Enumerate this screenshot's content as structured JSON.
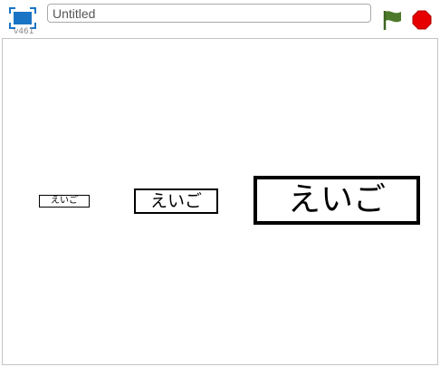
{
  "toolbar": {
    "fullscreen_icon": "fullscreen-icon",
    "version": "v461",
    "title_value": "Untitled",
    "flag_icon": "green-flag-icon",
    "stop_icon": "stop-icon",
    "flag_color": "#4d7a2a",
    "stop_color": "#e60000",
    "fullscreen_color": "#1a74c5"
  },
  "stage": {
    "sprites": [
      {
        "text": "えいご",
        "size": "small"
      },
      {
        "text": "えいご",
        "size": "medium"
      },
      {
        "text": "えいご",
        "size": "large"
      }
    ]
  }
}
